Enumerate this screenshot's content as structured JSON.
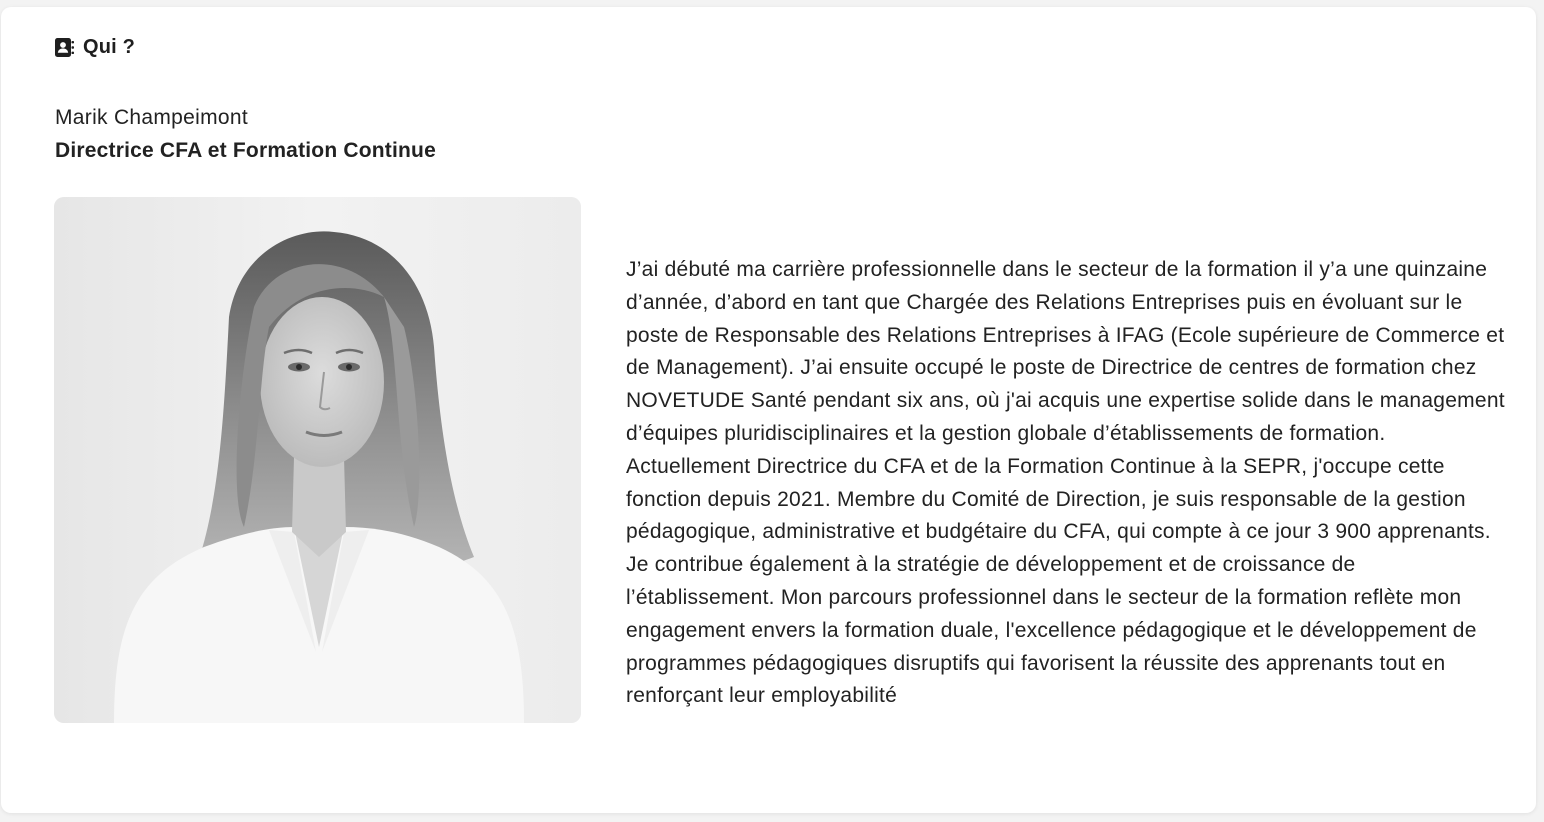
{
  "section": {
    "icon": "contact-book-icon",
    "title": "Qui ?"
  },
  "person": {
    "name": "Marik Champeimont",
    "role": "Directrice CFA et Formation Continue",
    "photo_description": "portrait-photo",
    "bio": "J’ai débuté ma carrière professionnelle dans le secteur de la formation il y’a une quinzaine d’année, d’abord en tant que Chargée des Relations Entreprises puis en évoluant sur le poste de Responsable des Relations Entreprises à IFAG (Ecole supérieure de Commerce et de Management). J’ai ensuite occupé le poste de Directrice de centres de formation chez NOVETUDE Santé pendant six ans, où j'ai acquis une expertise solide dans le management d’équipes pluridisciplinaires et la gestion globale d’établissements de formation. Actuellement Directrice du CFA et de la Formation Continue à la SEPR, j'occupe cette fonction depuis 2021. Membre du Comité de Direction, je suis responsable de la gestion pédagogique, administrative et budgétaire du CFA, qui compte à ce jour 3 900 apprenants. Je contribue également à la stratégie de développement et de croissance de l’établissement. Mon parcours professionnel dans le secteur de la formation reflète mon engagement envers la formation duale, l'excellence pédagogique et le développement de programmes pédagogiques disruptifs qui favorisent la réussite des apprenants tout en renforçant leur employabilité"
  },
  "colors": {
    "background": "#f3f3f3",
    "card": "#ffffff",
    "text": "#222222"
  }
}
